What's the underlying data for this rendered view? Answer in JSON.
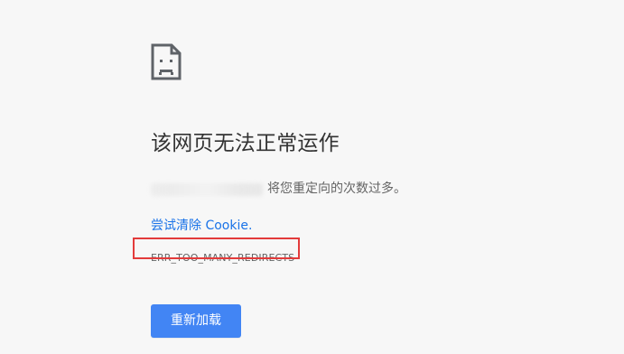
{
  "page": {
    "title": "该网页无法正常运作",
    "message": " 将您重定向的次数过多。",
    "cookie_link": "尝试清除 Cookie.",
    "error_code": "ERR_TOO_MANY_REDIRECTS",
    "reload_button": "重新加载"
  },
  "icons": {
    "error": "sad-document-icon"
  },
  "colors": {
    "background": "#f7f7f7",
    "title": "#333333",
    "body_text": "#646464",
    "link": "#1a73e8",
    "button": "#4285f4",
    "highlight": "#e33b3b"
  }
}
